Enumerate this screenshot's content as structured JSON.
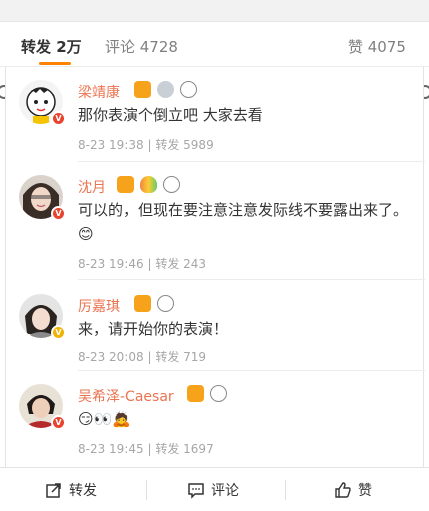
{
  "tabs": [
    {
      "label": "转发 2万",
      "active": true
    },
    {
      "label": "评论 4728",
      "active": false
    },
    {
      "label": "赞 4075",
      "active": false
    }
  ],
  "accent_color": "#ff8200",
  "name_color": "#eb7350",
  "comments": [
    {
      "name": "梁靖康",
      "text": "那你表演个倒立吧 大家去看",
      "time": "8-23 19:38",
      "repost": "转发 5989",
      "verified": "red",
      "icons": [
        "crown-badge-icon",
        "medal-icon",
        "panda-icon"
      ]
    },
    {
      "name": "沈月",
      "text": "可以的，但现在要注意注意发际线不要露出来了。",
      "emoji": "😊",
      "time": "8-23 19:46",
      "repost": "转发 243",
      "verified": "red",
      "icons": [
        "crown-badge-icon",
        "balloon-icon",
        "panda-icon"
      ]
    },
    {
      "name": "厉嘉琪",
      "text": "来，请开始你的表演！",
      "time": "8-23 20:08",
      "repost": "转发 719",
      "verified": "gold",
      "icons": [
        "crown-badge-icon",
        "panda-icon"
      ]
    },
    {
      "name": "吴希泽-Caesar",
      "text": "😏👀🙇",
      "time": "8-23 19:45",
      "repost": "转发 1697",
      "verified": "red",
      "icons": [
        "crown-badge-icon",
        "panda-icon"
      ]
    }
  ],
  "meta_separator": "|",
  "bottom": {
    "repost": "转发",
    "comment": "评论",
    "like": "赞"
  }
}
